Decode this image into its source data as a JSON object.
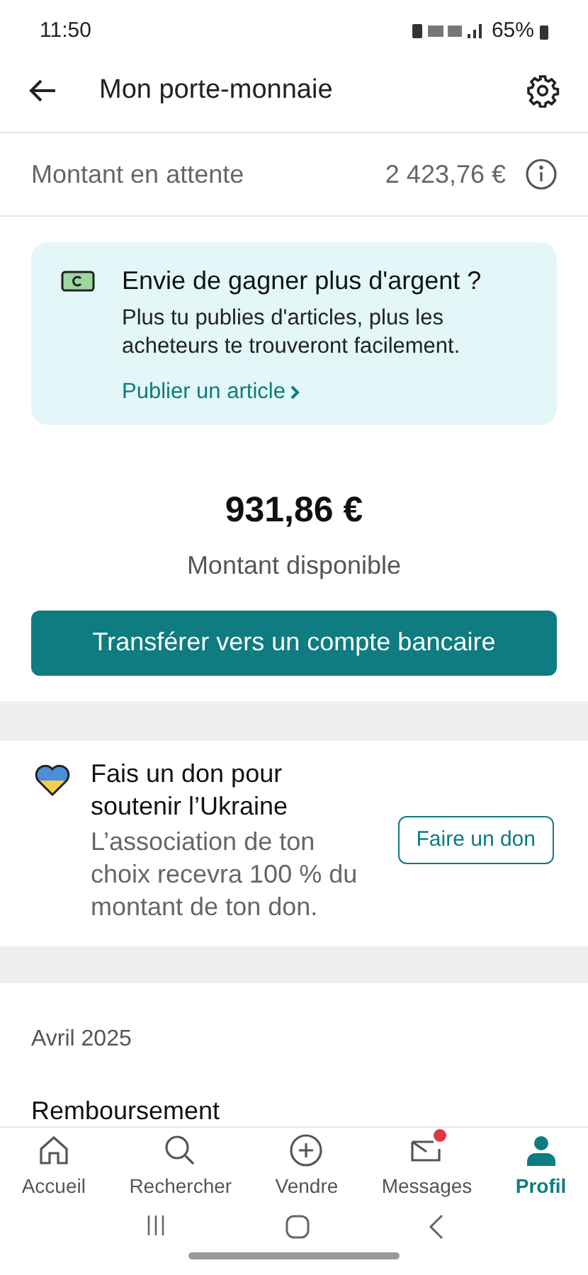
{
  "status_bar": {
    "time": "11:50",
    "battery": "65%"
  },
  "header": {
    "title": "Mon porte-monnaie"
  },
  "pending": {
    "label": "Montant en attente",
    "amount": "2 423,76 €"
  },
  "promo": {
    "title": "Envie de gagner plus d'argent ?",
    "text": "Plus tu publies d'articles, plus les acheteurs te trouveront facilement.",
    "link": "Publier un article"
  },
  "balance": {
    "amount": "931,86 €",
    "label": "Montant disponible"
  },
  "transfer_button": "Transférer vers un compte bancaire",
  "donation": {
    "title": "Fais un don pour soutenir l’Ukraine",
    "text": "L’association de ton choix recevra 100 % du montant de ton don.",
    "button": "Faire un don"
  },
  "history": {
    "month": "Avril 2025",
    "first_entry": "Remboursement"
  },
  "tabs": [
    {
      "kind": "home",
      "label": "Accueil",
      "selected": false,
      "unread": false
    },
    {
      "kind": "search",
      "label": "Rechercher",
      "selected": false,
      "unread": false
    },
    {
      "kind": "sell",
      "label": "Vendre",
      "selected": false,
      "unread": false
    },
    {
      "kind": "messages",
      "label": "Messages",
      "selected": false,
      "unread": true
    },
    {
      "kind": "profile",
      "label": "Profil",
      "selected": true,
      "unread": false
    }
  ]
}
